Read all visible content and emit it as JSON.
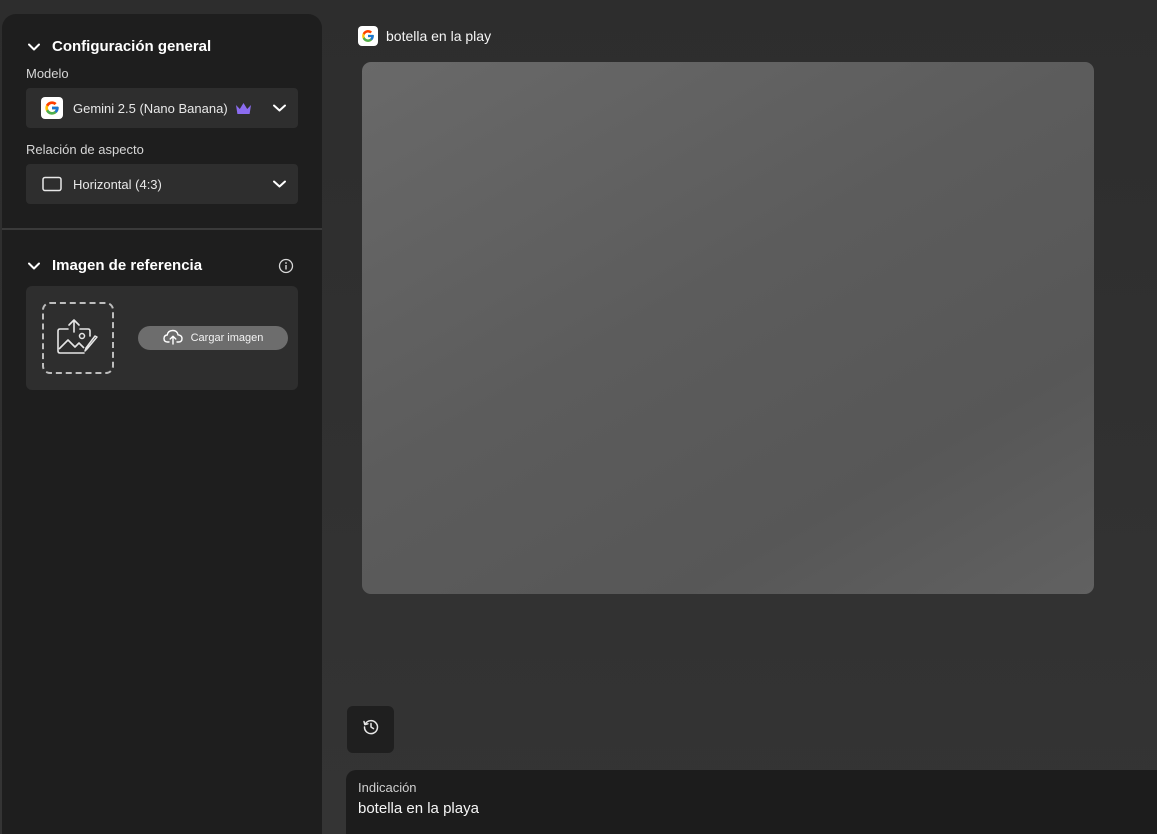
{
  "sidebar": {
    "general": {
      "title": "Configuración general",
      "model_label": "Modelo",
      "model_value": "Gemini 2.5 (Nano Banana)",
      "aspect_label": "Relación de aspecto",
      "aspect_value": "Horizontal (4:3)"
    },
    "reference": {
      "title": "Imagen de referencia",
      "upload_label": "Cargar imagen"
    }
  },
  "main": {
    "title": "botella en la play",
    "prompt_label": "Indicación",
    "prompt_value": "botella en la playa"
  },
  "icons": {
    "model": "google-icon",
    "premium": "crown-icon",
    "aspect": "rectangle-icon",
    "info": "info-icon",
    "upload": "cloud-upload-icon",
    "reference_placeholder": "image-upload-icon",
    "history": "history-icon"
  },
  "colors": {
    "sidebar_bg": "#1e1e1e",
    "panel_bg": "#2e2e2e",
    "crown": "#8b6cf0",
    "upload_button": "#6d6d6d"
  }
}
